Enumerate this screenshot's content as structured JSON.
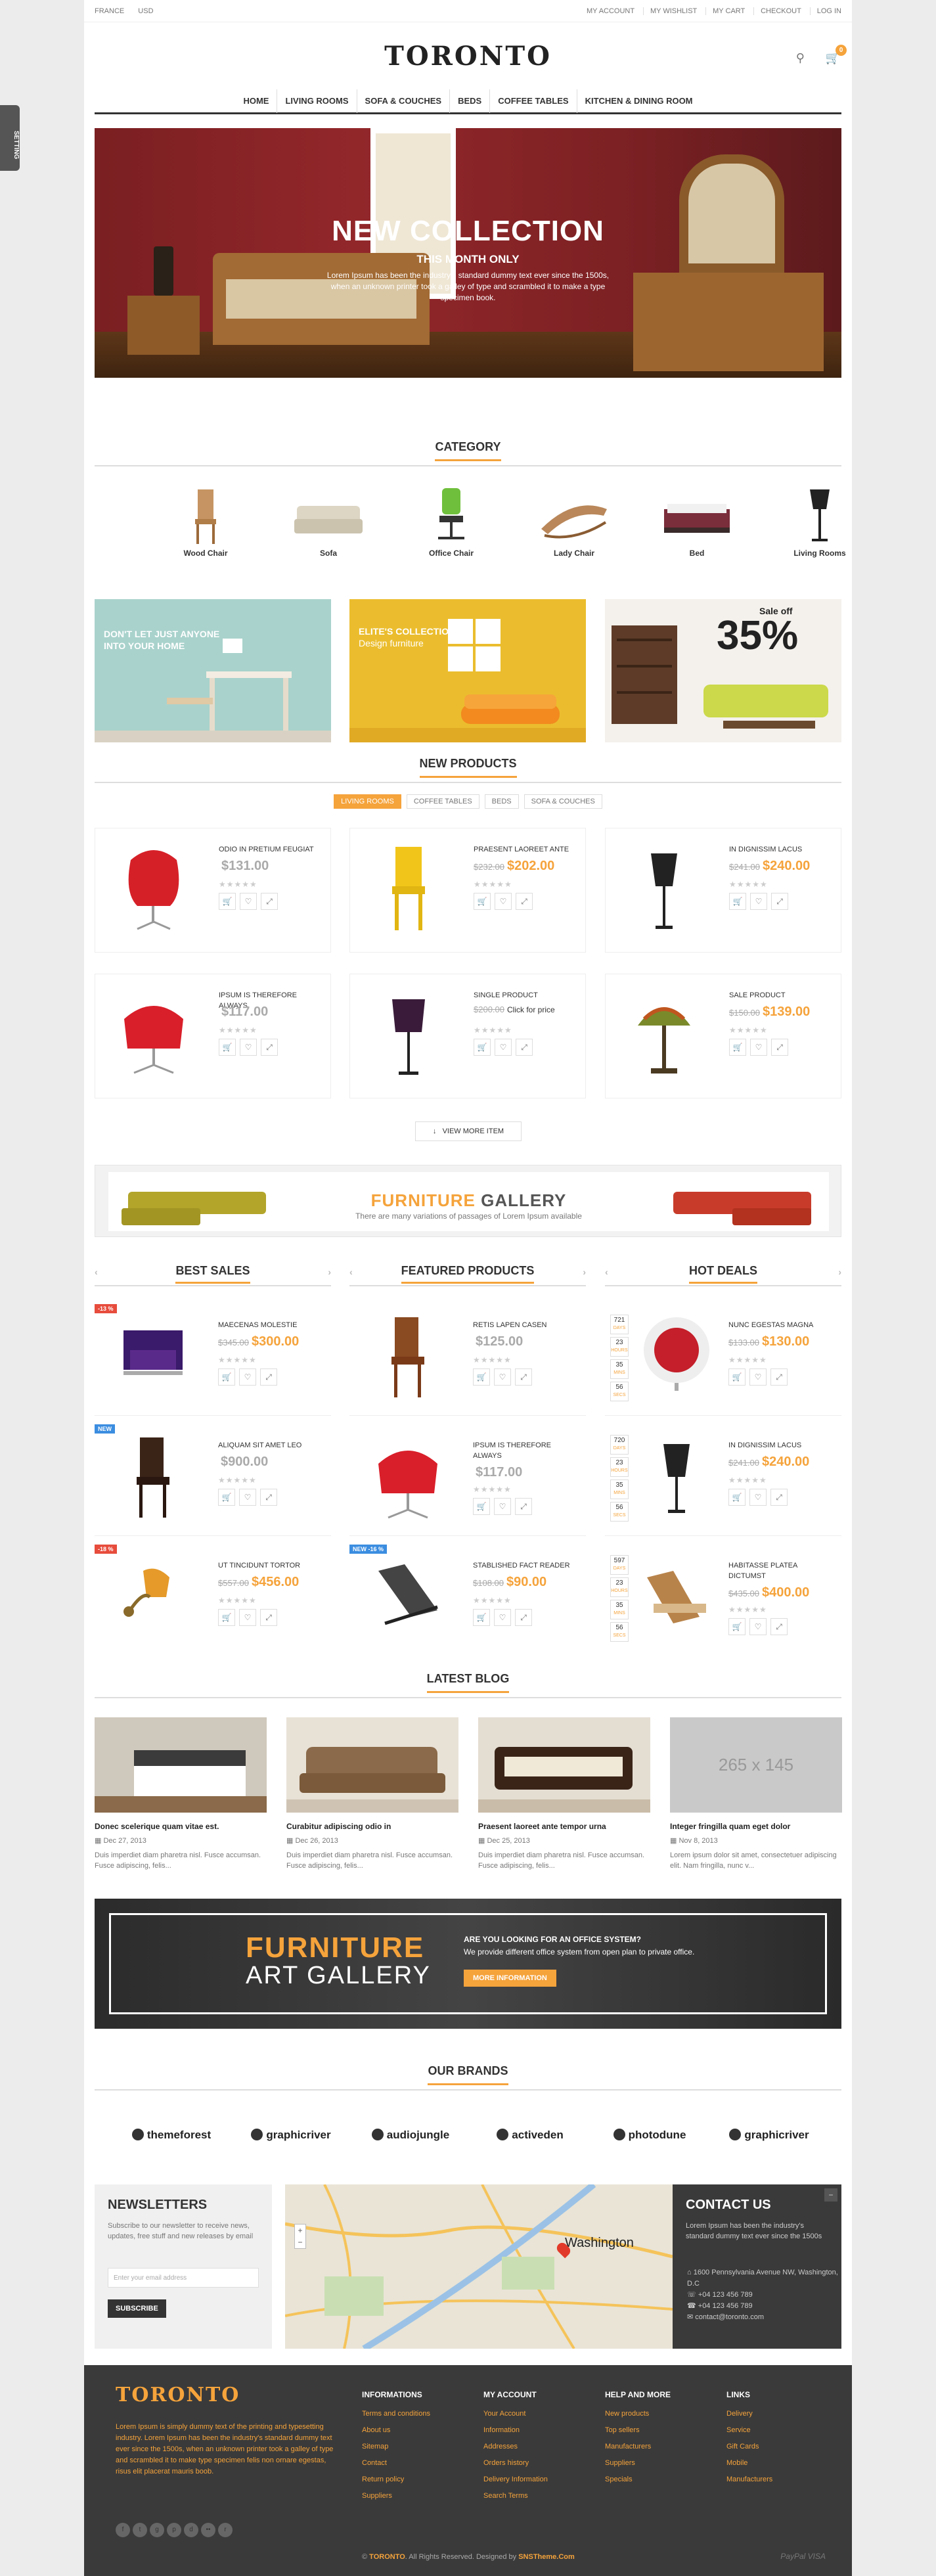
{
  "topbar": {
    "left": [
      "FRANCE",
      "USD"
    ],
    "right": [
      "MY ACCOUNT",
      "MY WISHLIST",
      "MY CART",
      "CHECKOUT",
      "LOG IN"
    ]
  },
  "side_tab": "SETTING",
  "logo": "TORONTO",
  "cart_count": "0",
  "nav": [
    "HOME",
    "LIVING ROOMS",
    "SOFA & COUCHES",
    "BEDS",
    "COFFEE TABLES",
    "KITCHEN & DINING ROOM"
  ],
  "hero": {
    "title": "NEW COLLECTION",
    "subtitle": "THIS MONTH ONLY",
    "text": "Lorem Ipsum has been the industry's standard dummy text ever since the 1500s, when an unknown printer took a galley of type and scrambled it to make a type specimen book."
  },
  "category": {
    "title": "CATEGORY",
    "items": [
      "Wood Chair",
      "Sofa",
      "Office Chair",
      "Lady Chair",
      "Bed",
      "Living Rooms"
    ]
  },
  "banners": [
    {
      "text1": "DON'T LET JUST ANYONE",
      "text2": "INTO YOUR HOME"
    },
    {
      "text1": "ELITE'S COLLECTION",
      "text2": "Design furniture"
    },
    {
      "text1": "Sale off",
      "text2": "35%"
    }
  ],
  "new_products": {
    "title": "NEW PRODUCTS",
    "tabs": [
      "LIVING ROOMS",
      "COFFEE TABLES",
      "BEDS",
      "SOFA & COUCHES"
    ],
    "items": [
      {
        "name": "ODIO IN PRETIUM FEUGIAT",
        "old": "",
        "price": "$131.00"
      },
      {
        "name": "PRAESENT LAOREET ANTE",
        "old": "$232.00",
        "price": "$202.00"
      },
      {
        "name": "IN DIGNISSIM LACUS",
        "old": "$241.00",
        "price": "$240.00"
      },
      {
        "name": "IPSUM IS THEREFORE ALWAYS",
        "old": "",
        "price": "$117.00"
      },
      {
        "name": "SINGLE PRODUCT",
        "old": "$200.00",
        "price": "Click for price"
      },
      {
        "name": "SALE PRODUCT",
        "old": "$150.00",
        "price": "$139.00"
      }
    ],
    "view_more": "VIEW MORE ITEM"
  },
  "gallery": {
    "word1": "FURNITURE",
    "word2": "GALLERY",
    "text": "There are many variations of passages of Lorem Ipsum available"
  },
  "columns": [
    {
      "title": "BEST SALES",
      "items": [
        {
          "tag": "-13 %",
          "name": "MAECENAS MOLESTIE",
          "old": "$345.00",
          "price": "$300.00"
        },
        {
          "tag": "NEW",
          "name": "ALIQUAM SIT AMET LEO",
          "old": "",
          "price": "$900.00"
        },
        {
          "tag": "-18 %",
          "name": "UT TINCIDUNT TORTOR",
          "old": "$557.00",
          "price": "$456.00"
        }
      ]
    },
    {
      "title": "FEATURED PRODUCTS",
      "items": [
        {
          "tag": "",
          "name": "RETIS LAPEN CASEN",
          "old": "",
          "price": "$125.00"
        },
        {
          "tag": "",
          "name": "IPSUM IS THEREFORE ALWAYS",
          "old": "",
          "price": "$117.00"
        },
        {
          "tag": "NEW -16 %",
          "name": "STABLISHED FACT READER",
          "old": "$108.00",
          "price": "$90.00"
        }
      ]
    },
    {
      "title": "HOT DEALS",
      "items": [
        {
          "cd": [
            "721",
            "23",
            "35",
            "56"
          ],
          "name": "NUNC EGESTAS MAGNA",
          "old": "$133.00",
          "price": "$130.00"
        },
        {
          "cd": [
            "720",
            "23",
            "35",
            "56"
          ],
          "name": "IN DIGNISSIM LACUS",
          "old": "$241.00",
          "price": "$240.00"
        },
        {
          "cd": [
            "597",
            "23",
            "35",
            "56"
          ],
          "name": "HABITASSE PLATEA DICTUMST",
          "old": "$435.00",
          "price": "$400.00"
        }
      ]
    }
  ],
  "countdown_units": [
    "DAYS",
    "HOURS",
    "MINS",
    "SECS"
  ],
  "blog": {
    "title": "LATEST BLOG",
    "posts": [
      {
        "title": "Donec scelerique quam vitae est.",
        "date": "Dec 27, 2013",
        "excerpt": "Duis imperdiet diam pharetra nisl. Fusce accumsan. Fusce adipiscing, felis..."
      },
      {
        "title": "Curabitur adipiscing odio in",
        "date": "Dec 26, 2013",
        "excerpt": "Duis imperdiet diam pharetra nisl. Fusce accumsan. Fusce adipiscing, felis..."
      },
      {
        "title": "Praesent laoreet ante tempor urna",
        "date": "Dec 25, 2013",
        "excerpt": "Duis imperdiet diam pharetra nisl. Fusce accumsan. Fusce adipiscing, felis..."
      },
      {
        "title": "Integer fringilla quam eget dolor",
        "date": "Nov 8, 2013",
        "excerpt": "Lorem ipsum dolor sit amet, consectetuer adipiscing elit. Nam fringilla, nunc v..."
      }
    ],
    "placeholder": "265 x 145"
  },
  "art": {
    "word1": "FURNITURE",
    "word2": "ART GALLERY",
    "question": "ARE YOU LOOKING FOR AN OFFICE SYSTEM?",
    "desc": "We provide different office system from open plan to private office.",
    "button": "MORE INFORMATION"
  },
  "brands": {
    "title": "OUR BRANDS",
    "items": [
      "themeforest",
      "graphicriver",
      "audiojungle",
      "activeden",
      "photodune",
      "graphicriver"
    ]
  },
  "newsletter": {
    "title": "NEWSLETTERS",
    "text": "Subscribe to our newsletter to receive news, updates, free stuff and new releases by email",
    "placeholder": "Enter your email address",
    "button": "SUBSCRIBE"
  },
  "map_label": "Washington",
  "contact": {
    "title": "CONTACT US",
    "text": "Lorem Ipsum has been the industry's standard dummy text ever since the 1500s",
    "lines": [
      "1600 Pennsylvania Avenue NW, Washington, D.C",
      "+04 123 456 789",
      "+04 123 456 789",
      "contact@toronto.com"
    ]
  },
  "footer": {
    "logo": "TORONTO",
    "text": "Lorem Ipsum is simply dummy text of the printing and typesetting industry. Lorem Ipsum has been the industry's standard dummy text ever since the 1500s, when an unknown printer took a galley of type and scrambled it to make type specimen felis non ornare egestas, risus elit placerat mauris boob.",
    "cols": [
      {
        "title": "INFORMATIONS",
        "items": [
          "Terms and conditions",
          "About us",
          "Sitemap",
          "Contact",
          "Return policy",
          "Suppliers"
        ]
      },
      {
        "title": "MY ACCOUNT",
        "items": [
          "Your Account",
          "Information",
          "Addresses",
          "Orders history",
          "Delivery Information",
          "Search Terms"
        ]
      },
      {
        "title": "HELP AND MORE",
        "items": [
          "New products",
          "Top sellers",
          "Manufacturers",
          "Suppliers",
          "Specials"
        ]
      },
      {
        "title": "LINKS",
        "items": [
          "Delivery",
          "Service",
          "Gift Cards",
          "Mobile",
          "Manufacturers"
        ]
      }
    ],
    "copy_prefix": "© ",
    "copy_brand": "TORONTO",
    "copy_mid": ". All Rights Reserved. Designed by ",
    "copy_designer": "SNSTheme.Com",
    "pay": "PayPal  VISA"
  },
  "colors": {
    "accent": "#f5a33b",
    "dark": "#3a3a3a",
    "sale_tag": "#e74c3c",
    "new_tag": "#3b8de0"
  }
}
